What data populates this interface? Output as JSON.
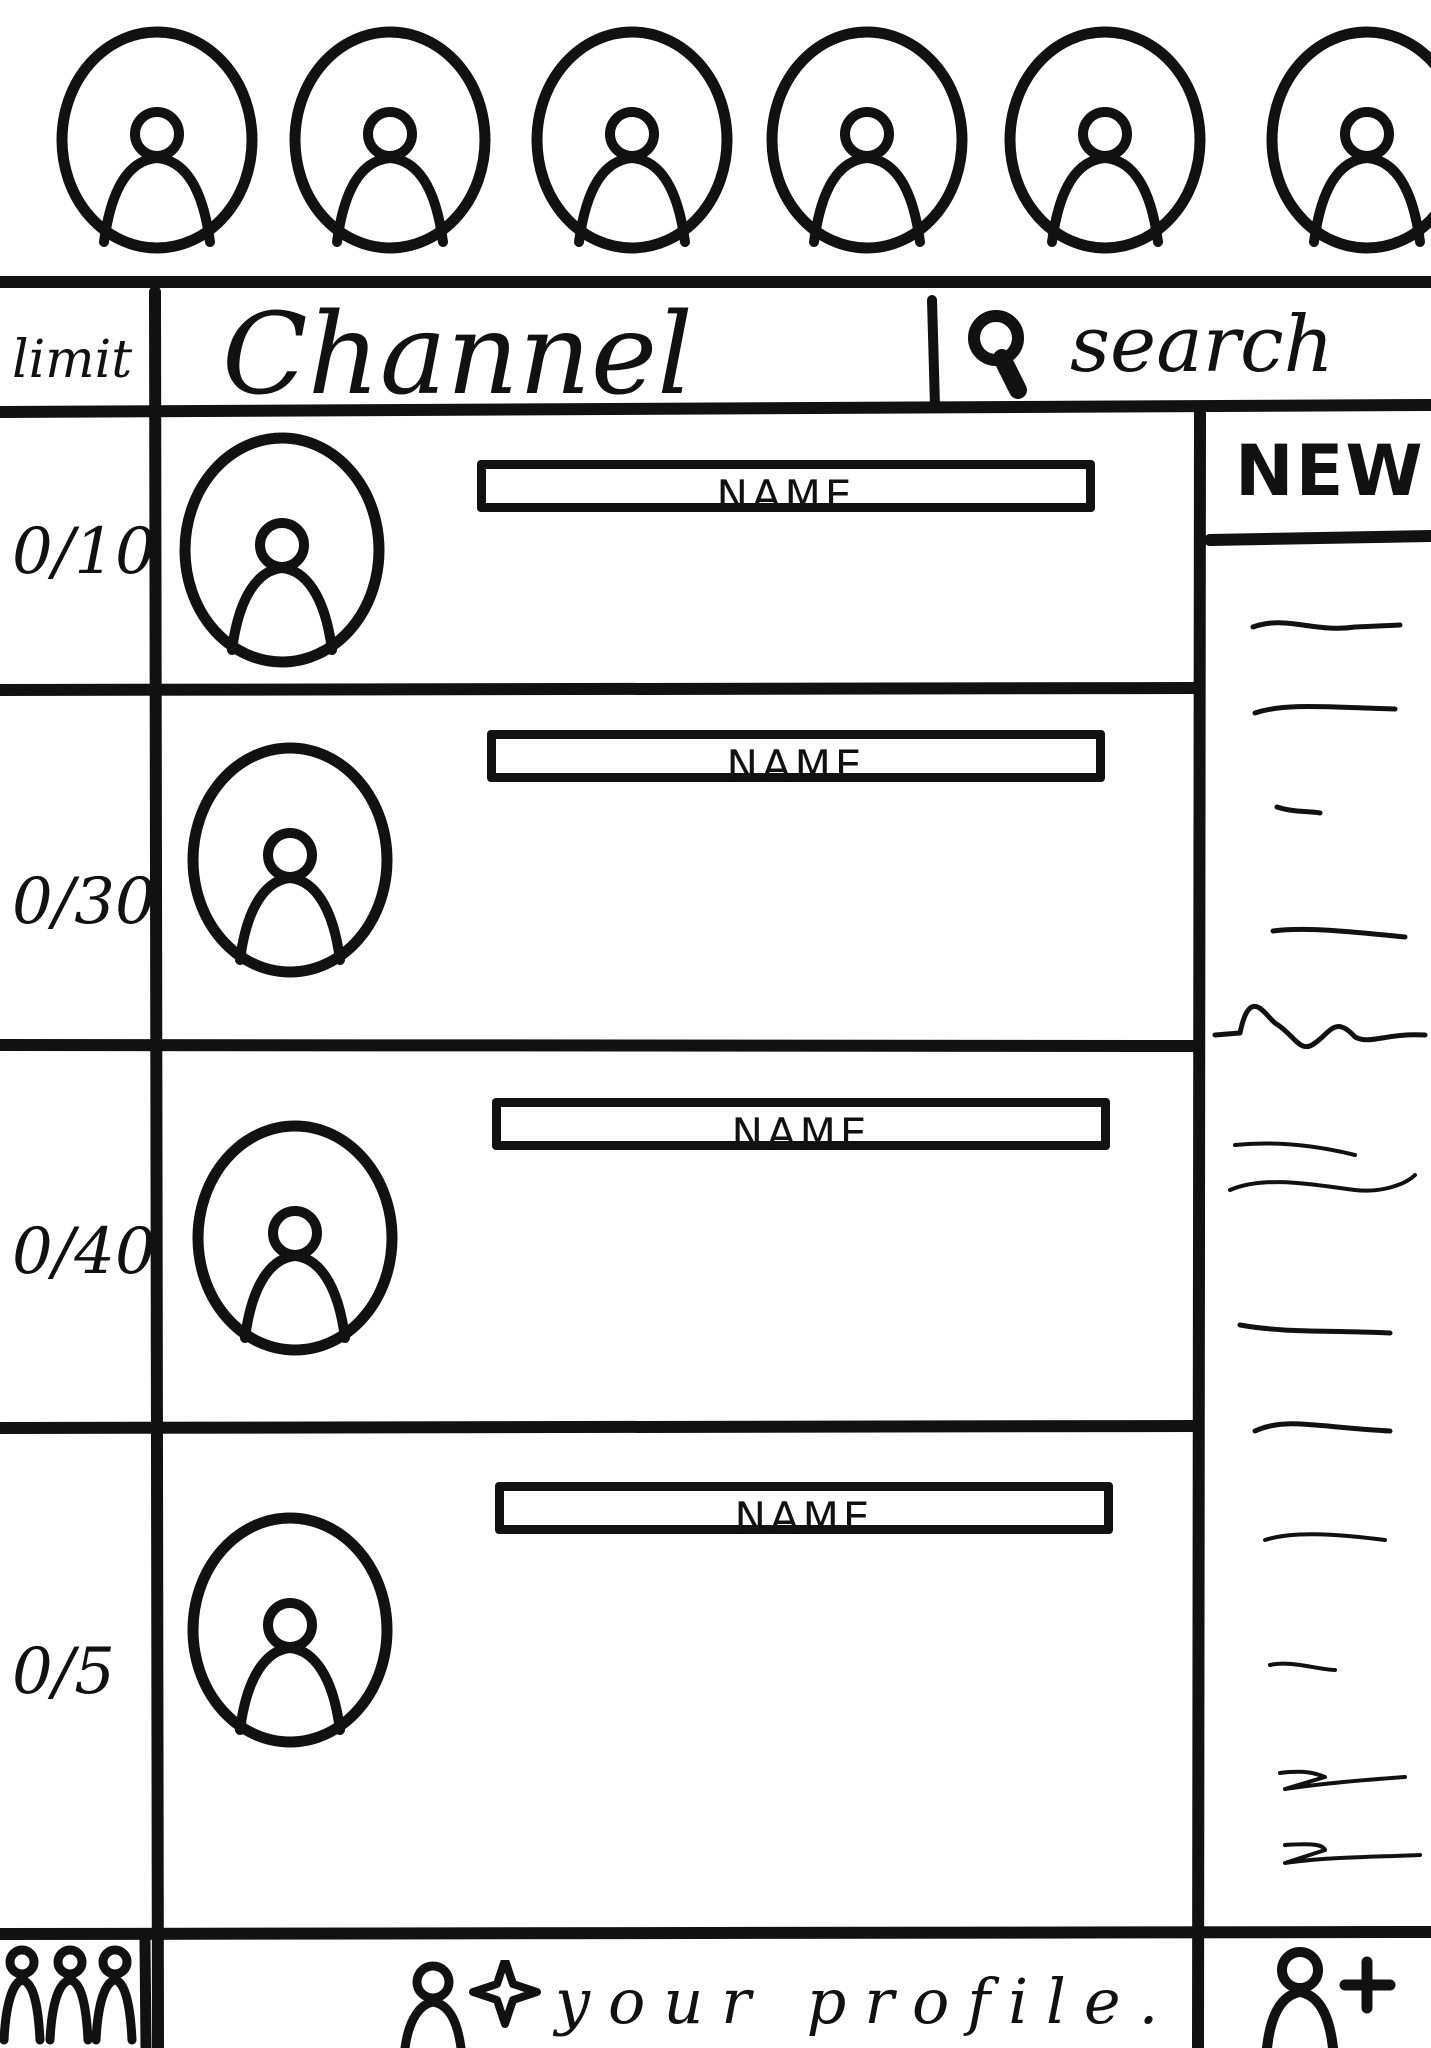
{
  "stories": {
    "items": [
      {
        "icon": "user-icon"
      },
      {
        "icon": "user-icon"
      },
      {
        "icon": "user-icon"
      },
      {
        "icon": "user-icon"
      },
      {
        "icon": "user-icon"
      },
      {
        "icon": "user-icon"
      }
    ]
  },
  "header": {
    "limit_label": "limit",
    "channel_label": "Channel",
    "search_label": "search",
    "search_icon": "search-icon"
  },
  "channels": [
    {
      "limit": "0/10",
      "name": "NAME"
    },
    {
      "limit": "0/30",
      "name": "NAME"
    },
    {
      "limit": "0/40",
      "name": "NAME"
    },
    {
      "limit": "0/5",
      "name": "NAME"
    }
  ],
  "sidebar": {
    "new_label": "NEW"
  },
  "bottom_bar": {
    "groups_icon": "groups-icon",
    "profile_icon": "profile-sparkle-icon",
    "profile_label": "your profile.",
    "add_user_icon": "add-user-icon"
  }
}
